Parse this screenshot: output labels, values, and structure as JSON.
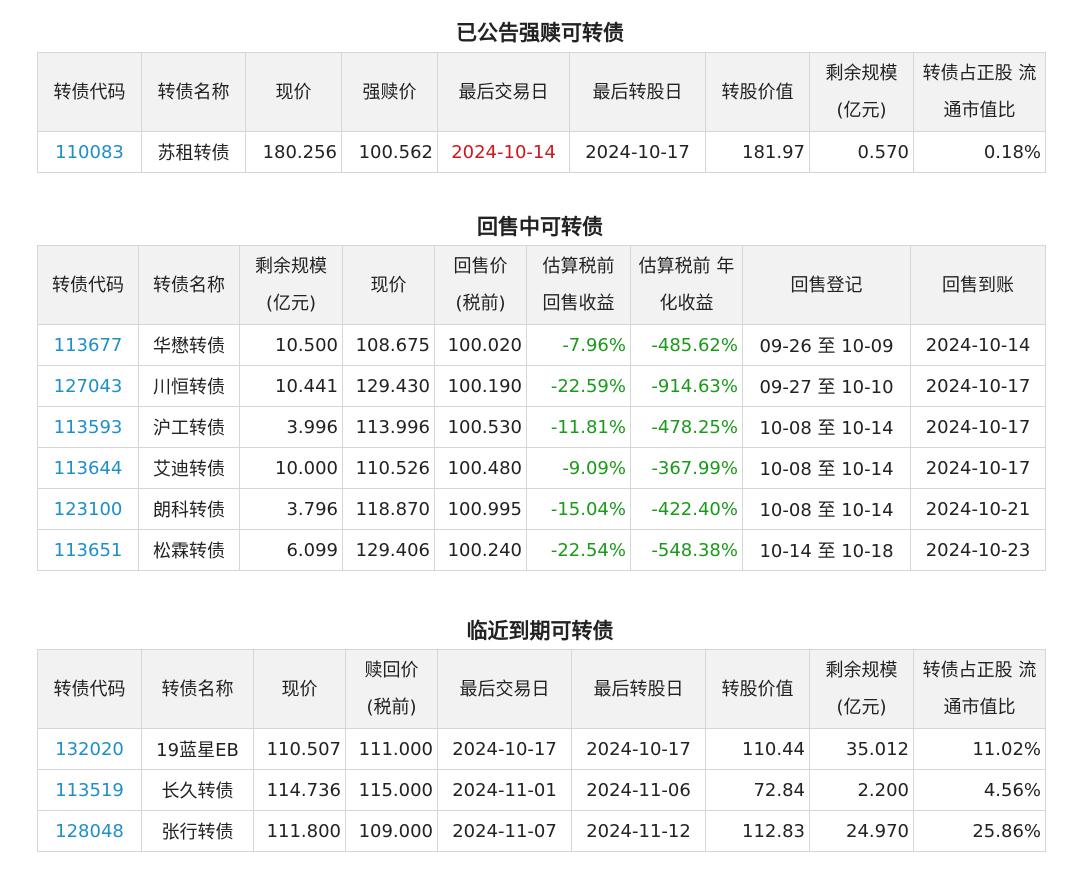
{
  "sections": [
    {
      "title": "已公告强赎可转债",
      "headers": [
        "转债代码",
        "转债名称",
        "现价",
        "强赎价",
        "最后交易日",
        "最后转股日",
        "转股价值",
        "剩余规模 (亿元)",
        "转债占正股 流通市值比"
      ],
      "rows": [
        [
          "110083",
          "苏租转债",
          "180.256",
          "100.562",
          "2024-10-14",
          "2024-10-17",
          "181.97",
          "0.570",
          "0.18%"
        ]
      ]
    },
    {
      "title": "回售中可转债",
      "headers": [
        "转债代码",
        "转债名称",
        "剩余规模 (亿元)",
        "现价",
        "回售价 (税前)",
        "估算税前 回售收益",
        "估算税前 年化收益",
        "回售登记",
        "回售到账"
      ],
      "rows": [
        [
          "113677",
          "华懋转债",
          "10.500",
          "108.675",
          "100.020",
          "-7.96%",
          "-485.62%",
          "09-26 至 10-09",
          "2024-10-14"
        ],
        [
          "127043",
          "川恒转债",
          "10.441",
          "129.430",
          "100.190",
          "-22.59%",
          "-914.63%",
          "09-27 至 10-10",
          "2024-10-17"
        ],
        [
          "113593",
          "沪工转债",
          "3.996",
          "113.996",
          "100.530",
          "-11.81%",
          "-478.25%",
          "10-08 至 10-14",
          "2024-10-17"
        ],
        [
          "113644",
          "艾迪转债",
          "10.000",
          "110.526",
          "100.480",
          "-9.09%",
          "-367.99%",
          "10-08 至 10-14",
          "2024-10-17"
        ],
        [
          "123100",
          "朗科转债",
          "3.796",
          "118.870",
          "100.995",
          "-15.04%",
          "-422.40%",
          "10-08 至 10-14",
          "2024-10-21"
        ],
        [
          "113651",
          "松霖转债",
          "6.099",
          "129.406",
          "100.240",
          "-22.54%",
          "-548.38%",
          "10-14 至 10-18",
          "2024-10-23"
        ]
      ]
    },
    {
      "title": "临近到期可转债",
      "headers": [
        "转债代码",
        "转债名称",
        "现价",
        "赎回价 (税前)",
        "最后交易日",
        "最后转股日",
        "转股价值",
        "剩余规模 (亿元)",
        "转债占正股 流通市值比"
      ],
      "rows": [
        [
          "132020",
          "19蓝星EB",
          "110.507",
          "111.000",
          "2024-10-17",
          "2024-10-17",
          "110.44",
          "35.012",
          "11.02%"
        ],
        [
          "113519",
          "长久转债",
          "114.736",
          "115.000",
          "2024-11-01",
          "2024-11-06",
          "72.84",
          "2.200",
          "4.56%"
        ],
        [
          "128048",
          "张行转债",
          "111.800",
          "109.000",
          "2024-11-07",
          "2024-11-12",
          "112.83",
          "24.970",
          "25.86%"
        ]
      ]
    }
  ],
  "colors": {
    "code": "#1f8fc8",
    "negative": "#1a9a1a",
    "highlight": "#d0161b",
    "header_bg": "#f2f2f2",
    "border": "#d6d6d6"
  }
}
